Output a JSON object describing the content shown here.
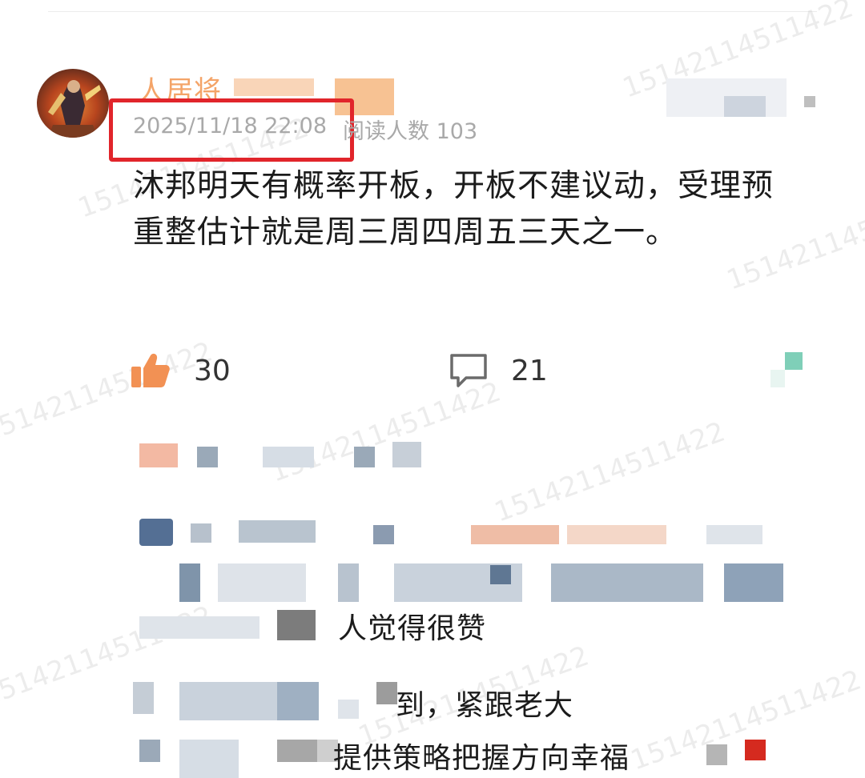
{
  "post": {
    "author": {
      "name_visible": "人居将",
      "avatar": "warrior-avatar"
    },
    "timestamp": "2025/11/18 22:08",
    "read_count": "阅读人数 103",
    "content": "沐邦明天有概率开板，开板不建议动，受理预重整估计就是周三周四周五三天之一。",
    "likes": "30",
    "comments": "21"
  },
  "replies": {
    "line1_suffix": "人觉得很赞",
    "line2_suffix": "到，紧跟老大",
    "line3_suffix": "提供策略把握方向幸福"
  },
  "watermark": "15142114511422",
  "colors": {
    "highlight_box": "#e1252b",
    "like_icon": "#f29154",
    "username": "#f4a468",
    "meta_text": "#a9a9a9"
  },
  "icons": [
    "thumbs-up-icon",
    "comment-bubble-icon",
    "share-icon"
  ]
}
